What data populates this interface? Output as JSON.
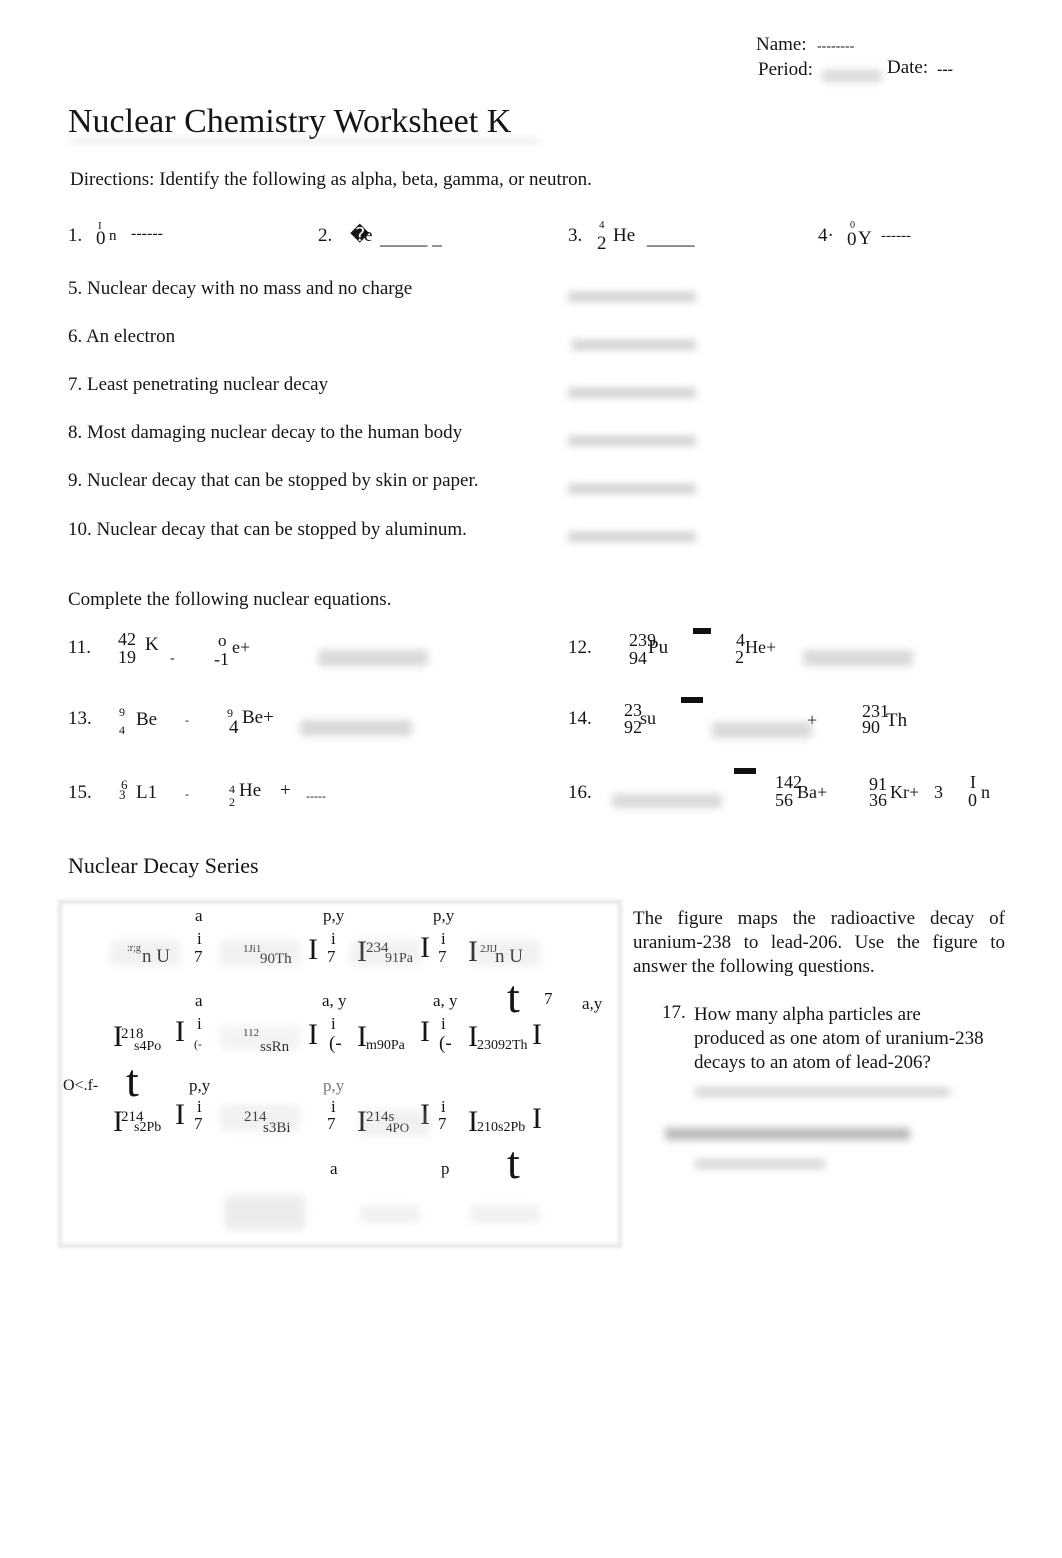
{
  "header": {
    "name_label": "Name:",
    "name_value": "--------",
    "period_label": "Period:",
    "date_label": "Date:",
    "date_value": "---"
  },
  "title": "Nuclear Chemistry Worksheet K",
  "directions": {
    "label": "Directions:",
    "text": " Identify the following as alpha, beta, gamma, or neutron."
  },
  "identify": [
    [
      "1.",
      "I",
      "0",
      "n",
      "------"
    ],
    [
      "2.",
      "�",
      "e",
      "_____ _"
    ],
    [
      "3.",
      "4",
      "2",
      "He",
      "_____"
    ],
    [
      "4·",
      "0",
      "0",
      "Y",
      "------"
    ]
  ],
  "questions": [
    "5.  Nuclear decay with no mass and no charge",
    "6. An electron",
    "7.  Least penetrating nuclear decay",
    "8.  Most damaging nuclear decay to the human body",
    "9.  Nuclear decay that can be stopped by skin or paper.",
    "10.  Nuclear decay that can be stopped by aluminum."
  ],
  "equations_heading": "Complete the following nuclear equations.",
  "equations": {
    "q11": [
      "11.",
      "42",
      "19",
      "K",
      "-",
      "o",
      "-1",
      "e+"
    ],
    "q12": [
      "12.",
      "239",
      "94",
      "Pu",
      "4",
      "2",
      "He+"
    ],
    "q13": [
      "13.",
      "9",
      "4",
      "Be",
      "-",
      "9",
      "4",
      "Be+"
    ],
    "q14": [
      "14.",
      "23",
      "92",
      "su",
      "+",
      "231",
      "90",
      "Th"
    ],
    "q15": [
      "15.",
      "6",
      "3",
      "L1",
      "-",
      "4",
      "2",
      "He",
      "+",
      "-----"
    ],
    "q16": [
      "16.",
      "142",
      "56",
      "Ba+",
      "91",
      "36",
      "Kr+",
      "3",
      "I",
      "0",
      "n"
    ]
  },
  "series_heading": "Nuclear Decay Series",
  "series": [
    "a",
    "i",
    "7",
    ":r;g",
    "n U",
    "1Ji1",
    "90Th",
    "I",
    "p,y",
    "i",
    "7",
    "I",
    "234",
    "91Pa",
    "I",
    "p,y",
    "i",
    "7",
    "I",
    "2JlJ",
    "n U",
    "a",
    "a, y",
    "a, y",
    "t",
    "7",
    "a,y",
    "I",
    "218",
    "s4Po",
    "I",
    "i",
    "(-",
    "112",
    "ssRn",
    "I",
    "i",
    "(-",
    "I",
    "m90Pa",
    "I",
    "i",
    "(-",
    "I",
    "23092Th",
    "I",
    "O<.f-",
    "t",
    "p,y",
    "p,y",
    "I",
    "214",
    "s2Pb",
    "I",
    "i",
    "7",
    "214",
    "s3Bi",
    "i",
    "7",
    "I",
    "214s",
    "4PO",
    "I",
    "i",
    "7",
    "I",
    "210s2Pb",
    "I",
    "a",
    "p",
    "t"
  ],
  "figure_text": "The figure maps the radioactive decay of uranium-238 to lead-206.   Use the figure to answer the following questions.",
  "q17": {
    "num": "17.",
    "text": "How many alpha particles are produced as one atom of uranium-238 decays to an atom of lead-206?"
  }
}
